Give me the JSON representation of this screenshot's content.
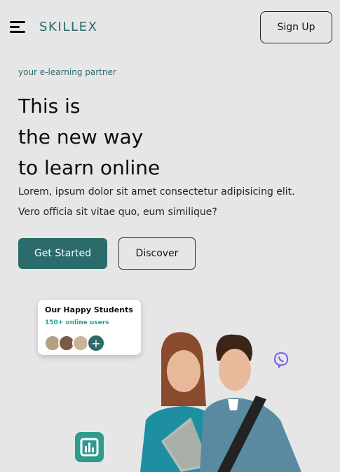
{
  "header": {
    "menu_icon": "hamburger-menu-icon",
    "logo": "SKILLEX",
    "signup_label": "Sign Up"
  },
  "hero": {
    "tagline": "your e-learning partner",
    "headline_lines": [
      "This is",
      "the new way",
      "to learn online"
    ],
    "description": "Lorem, ipsum dolor sit amet consectetur adipisicing elit. Vero officia sit vitae quo, eum similique?",
    "primary_button": "Get Started",
    "secondary_button": "Discover"
  },
  "students_card": {
    "title": "Our Happy Students",
    "subtitle": "150+ online users",
    "add_symbol": "+"
  },
  "floating_icons": {
    "messenger_icon": "viber-icon",
    "analytics_icon": "bar-chart-icon"
  },
  "colors": {
    "brand": "#2b6b69",
    "accent": "#2a9d8f",
    "background": "#e6e6e7",
    "messenger": "#7360f2"
  }
}
